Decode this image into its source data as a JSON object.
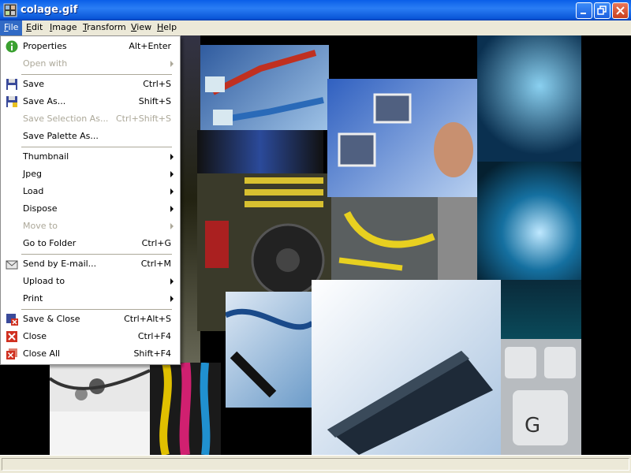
{
  "window": {
    "title": "colage.gif"
  },
  "menubar": {
    "items": [
      {
        "label": "File",
        "accel": "F",
        "rest": "ile",
        "active": true
      },
      {
        "label": "Edit",
        "accel": "E",
        "rest": "dit"
      },
      {
        "label": "Image",
        "accel": "I",
        "rest": "mage"
      },
      {
        "label": "Transform",
        "accel": "T",
        "rest": "ransform"
      },
      {
        "label": "View",
        "accel": "V",
        "rest": "iew"
      },
      {
        "label": "Help",
        "accel": "H",
        "rest": "elp"
      }
    ]
  },
  "file_menu": {
    "items": [
      {
        "label": "Properties",
        "shortcut": "Alt+Enter",
        "icon": "info-icon"
      },
      {
        "label": "Open with",
        "disabled": true,
        "submenu": true
      },
      {
        "label": "Save",
        "shortcut": "Ctrl+S",
        "icon": "floppy-icon"
      },
      {
        "label": "Save As...",
        "shortcut": "Shift+S",
        "icon": "floppy-as-icon"
      },
      {
        "label": "Save Selection As...",
        "shortcut": "Ctrl+Shift+S",
        "disabled": true
      },
      {
        "label": "Save Palette As...",
        "shortcut": ""
      },
      {
        "label": "Thumbnail",
        "submenu": true
      },
      {
        "label": "Jpeg",
        "submenu": true
      },
      {
        "label": "Load",
        "submenu": true
      },
      {
        "label": "Dispose",
        "submenu": true
      },
      {
        "label": "Move to",
        "disabled": true,
        "submenu": true
      },
      {
        "label": "Go to Folder",
        "shortcut": "Ctrl+G"
      },
      {
        "label": "Send by E-mail...",
        "shortcut": "Ctrl+M",
        "icon": "email-icon"
      },
      {
        "label": "Upload to",
        "submenu": true
      },
      {
        "label": "Print",
        "submenu": true
      },
      {
        "label": "Save & Close",
        "shortcut": "Ctrl+Alt+S",
        "icon": "save-close-icon"
      },
      {
        "label": "Close",
        "shortcut": "Ctrl+F4",
        "icon": "close-x-icon"
      },
      {
        "label": "Close All",
        "shortcut": "Shift+F4",
        "icon": "close-all-icon"
      }
    ]
  },
  "colors": {
    "titlebar": "#0a5fe8",
    "menu_highlight": "#316ac5",
    "chrome": "#ece9d8",
    "disabled_text": "#aca899"
  }
}
